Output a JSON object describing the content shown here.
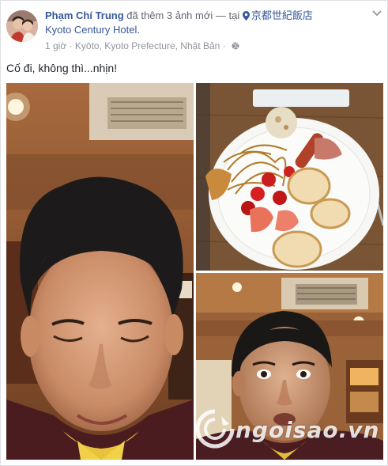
{
  "post": {
    "author": "Phạm Chí Trung",
    "action": "đã thêm 3 ảnh mới",
    "separator": "— tại",
    "location_name": "京都世紀飯店",
    "location_subtitle": "Kyoto Century Hotel.",
    "time": "1 giờ",
    "time_location_separator": "·",
    "region": "Kyōto, Kyoto Prefecture, Nhật Bản",
    "privacy_separator": "·",
    "privacy_icon": "globe-icon",
    "more_icon": "chevron-down-icon",
    "message": "Cố đi, không thì...nhịn!"
  },
  "watermark": {
    "text": "ngoisao.vn"
  },
  "colors": {
    "link_blue": "#365899",
    "meta_gray": "#90949c",
    "body_text": "#1d2129"
  }
}
